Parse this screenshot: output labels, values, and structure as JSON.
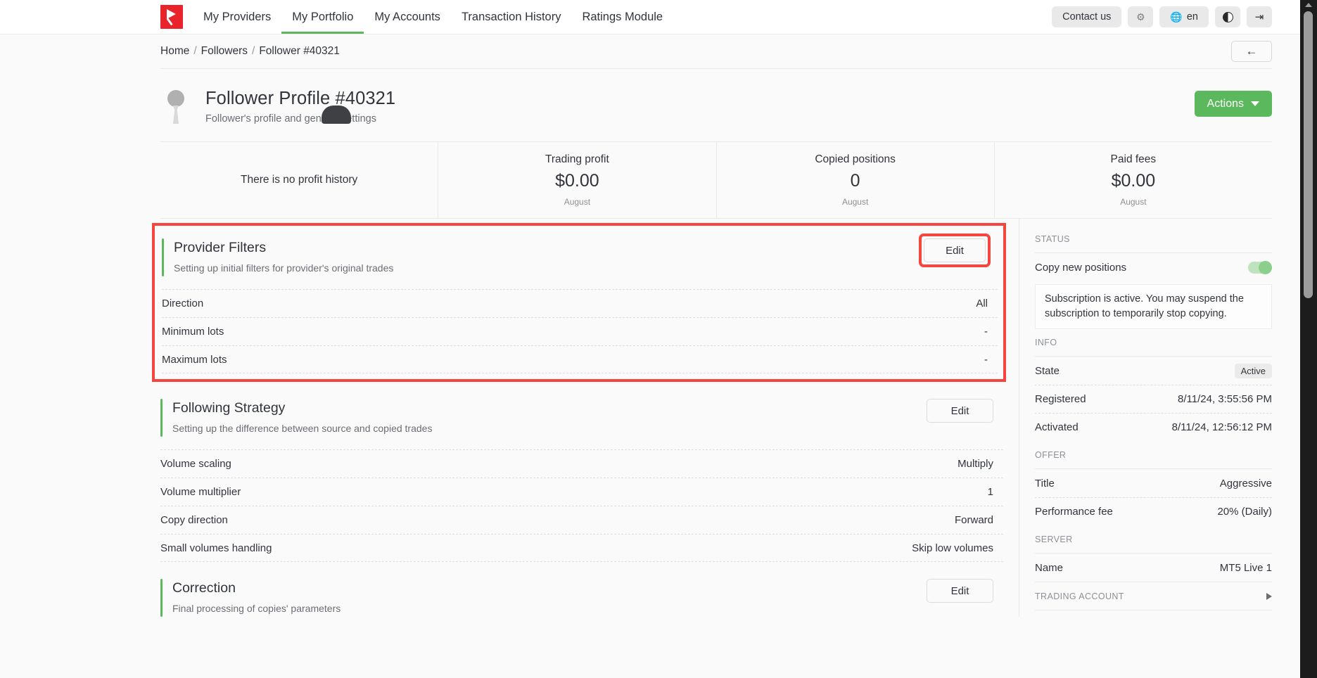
{
  "nav": {
    "logo_name": "brand-logo",
    "items": [
      {
        "label": "My Providers",
        "active": false
      },
      {
        "label": "My Portfolio",
        "active": true
      },
      {
        "label": "My Accounts",
        "active": false
      },
      {
        "label": "Transaction History",
        "active": false
      },
      {
        "label": "Ratings Module",
        "active": false
      }
    ],
    "contact_label": "Contact us",
    "settings_icon": "gear-icon",
    "language_icon": "globe-icon",
    "language_label": "en",
    "theme_icon": "contrast-toggle-icon",
    "logout_icon": "logout-icon"
  },
  "breadcrumb": {
    "items": [
      "Home",
      "Followers",
      "Follower #40321"
    ],
    "separator": "/",
    "back_icon": "arrow-left-icon"
  },
  "profile": {
    "avatar_icon": "user-avatar-icon",
    "title": "Follower Profile #40321",
    "subtitle": "Follower's profile and general settings",
    "actions_label": "Actions",
    "actions_caret": "chevron-down-icon"
  },
  "stats": [
    {
      "empty_text": "There is no profit history"
    },
    {
      "label": "Trading profit",
      "value": "$0.00",
      "period": "August"
    },
    {
      "label": "Copied positions",
      "value": "0",
      "period": "August"
    },
    {
      "label": "Paid fees",
      "value": "$0.00",
      "period": "August"
    }
  ],
  "sections": [
    {
      "title": "Provider Filters",
      "subtitle": "Setting up initial filters for provider's original trades",
      "edit_label": "Edit",
      "highlighted": true,
      "rows": [
        {
          "key": "Direction",
          "value": "All"
        },
        {
          "key": "Minimum lots",
          "value": "-"
        },
        {
          "key": "Maximum lots",
          "value": "-"
        }
      ]
    },
    {
      "title": "Following Strategy",
      "subtitle": "Setting up the difference between source and copied trades",
      "edit_label": "Edit",
      "highlighted": false,
      "rows": [
        {
          "key": "Volume scaling",
          "value": "Multiply"
        },
        {
          "key": "Volume multiplier",
          "value": "1"
        },
        {
          "key": "Copy direction",
          "value": "Forward"
        },
        {
          "key": "Small volumes handling",
          "value": "Skip low volumes"
        }
      ]
    },
    {
      "title": "Correction",
      "subtitle": "Final processing of copies' parameters",
      "edit_label": "Edit",
      "highlighted": false,
      "rows": []
    }
  ],
  "sidebar": {
    "status_title": "STATUS",
    "copy_new_positions_label": "Copy new positions",
    "copy_new_positions_on": true,
    "subscription_note": "Subscription is active. You may suspend the subscription to temporarily stop copying.",
    "info_title": "INFO",
    "info_rows": [
      {
        "key": "State",
        "value": "Active",
        "badge": true
      },
      {
        "key": "Registered",
        "value": "8/11/24, 3:55:56 PM",
        "badge": false
      },
      {
        "key": "Activated",
        "value": "8/11/24, 12:56:12 PM",
        "badge": false
      }
    ],
    "offer_title": "OFFER",
    "offer_rows": [
      {
        "key": "Title",
        "value": "Aggressive"
      },
      {
        "key": "Performance fee",
        "value": "20% (Daily)"
      }
    ],
    "server_title": "SERVER",
    "server_rows": [
      {
        "key": "Name",
        "value": "MT5 Live 1"
      }
    ],
    "trading_account_title": "TRADING ACCOUNT",
    "trading_account_icon": "chevron-right-icon"
  },
  "colors": {
    "brand_red": "#e8232a",
    "accent_green": "#5cb85c",
    "highlight_red": "#f4453f",
    "page_bg": "#fafafa"
  }
}
